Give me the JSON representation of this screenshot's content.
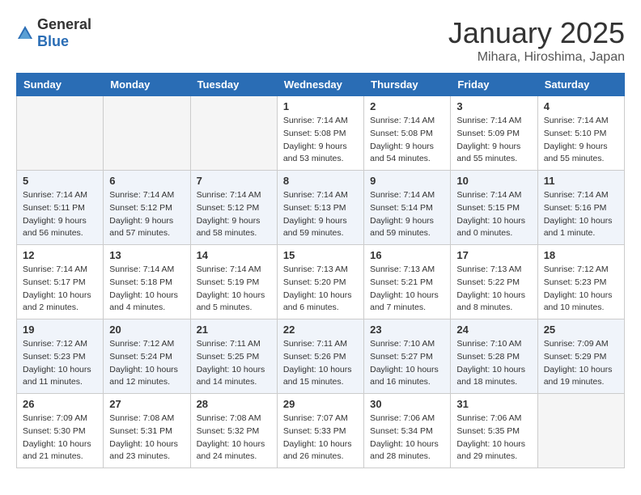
{
  "logo": {
    "general": "General",
    "blue": "Blue"
  },
  "title": "January 2025",
  "location": "Mihara, Hiroshima, Japan",
  "weekdays": [
    "Sunday",
    "Monday",
    "Tuesday",
    "Wednesday",
    "Thursday",
    "Friday",
    "Saturday"
  ],
  "weeks": [
    [
      {
        "day": "",
        "info": ""
      },
      {
        "day": "",
        "info": ""
      },
      {
        "day": "",
        "info": ""
      },
      {
        "day": "1",
        "info": "Sunrise: 7:14 AM\nSunset: 5:08 PM\nDaylight: 9 hours and 53 minutes."
      },
      {
        "day": "2",
        "info": "Sunrise: 7:14 AM\nSunset: 5:08 PM\nDaylight: 9 hours and 54 minutes."
      },
      {
        "day": "3",
        "info": "Sunrise: 7:14 AM\nSunset: 5:09 PM\nDaylight: 9 hours and 55 minutes."
      },
      {
        "day": "4",
        "info": "Sunrise: 7:14 AM\nSunset: 5:10 PM\nDaylight: 9 hours and 55 minutes."
      }
    ],
    [
      {
        "day": "5",
        "info": "Sunrise: 7:14 AM\nSunset: 5:11 PM\nDaylight: 9 hours and 56 minutes."
      },
      {
        "day": "6",
        "info": "Sunrise: 7:14 AM\nSunset: 5:12 PM\nDaylight: 9 hours and 57 minutes."
      },
      {
        "day": "7",
        "info": "Sunrise: 7:14 AM\nSunset: 5:12 PM\nDaylight: 9 hours and 58 minutes."
      },
      {
        "day": "8",
        "info": "Sunrise: 7:14 AM\nSunset: 5:13 PM\nDaylight: 9 hours and 59 minutes."
      },
      {
        "day": "9",
        "info": "Sunrise: 7:14 AM\nSunset: 5:14 PM\nDaylight: 9 hours and 59 minutes."
      },
      {
        "day": "10",
        "info": "Sunrise: 7:14 AM\nSunset: 5:15 PM\nDaylight: 10 hours and 0 minutes."
      },
      {
        "day": "11",
        "info": "Sunrise: 7:14 AM\nSunset: 5:16 PM\nDaylight: 10 hours and 1 minute."
      }
    ],
    [
      {
        "day": "12",
        "info": "Sunrise: 7:14 AM\nSunset: 5:17 PM\nDaylight: 10 hours and 2 minutes."
      },
      {
        "day": "13",
        "info": "Sunrise: 7:14 AM\nSunset: 5:18 PM\nDaylight: 10 hours and 4 minutes."
      },
      {
        "day": "14",
        "info": "Sunrise: 7:14 AM\nSunset: 5:19 PM\nDaylight: 10 hours and 5 minutes."
      },
      {
        "day": "15",
        "info": "Sunrise: 7:13 AM\nSunset: 5:20 PM\nDaylight: 10 hours and 6 minutes."
      },
      {
        "day": "16",
        "info": "Sunrise: 7:13 AM\nSunset: 5:21 PM\nDaylight: 10 hours and 7 minutes."
      },
      {
        "day": "17",
        "info": "Sunrise: 7:13 AM\nSunset: 5:22 PM\nDaylight: 10 hours and 8 minutes."
      },
      {
        "day": "18",
        "info": "Sunrise: 7:12 AM\nSunset: 5:23 PM\nDaylight: 10 hours and 10 minutes."
      }
    ],
    [
      {
        "day": "19",
        "info": "Sunrise: 7:12 AM\nSunset: 5:23 PM\nDaylight: 10 hours and 11 minutes."
      },
      {
        "day": "20",
        "info": "Sunrise: 7:12 AM\nSunset: 5:24 PM\nDaylight: 10 hours and 12 minutes."
      },
      {
        "day": "21",
        "info": "Sunrise: 7:11 AM\nSunset: 5:25 PM\nDaylight: 10 hours and 14 minutes."
      },
      {
        "day": "22",
        "info": "Sunrise: 7:11 AM\nSunset: 5:26 PM\nDaylight: 10 hours and 15 minutes."
      },
      {
        "day": "23",
        "info": "Sunrise: 7:10 AM\nSunset: 5:27 PM\nDaylight: 10 hours and 16 minutes."
      },
      {
        "day": "24",
        "info": "Sunrise: 7:10 AM\nSunset: 5:28 PM\nDaylight: 10 hours and 18 minutes."
      },
      {
        "day": "25",
        "info": "Sunrise: 7:09 AM\nSunset: 5:29 PM\nDaylight: 10 hours and 19 minutes."
      }
    ],
    [
      {
        "day": "26",
        "info": "Sunrise: 7:09 AM\nSunset: 5:30 PM\nDaylight: 10 hours and 21 minutes."
      },
      {
        "day": "27",
        "info": "Sunrise: 7:08 AM\nSunset: 5:31 PM\nDaylight: 10 hours and 23 minutes."
      },
      {
        "day": "28",
        "info": "Sunrise: 7:08 AM\nSunset: 5:32 PM\nDaylight: 10 hours and 24 minutes."
      },
      {
        "day": "29",
        "info": "Sunrise: 7:07 AM\nSunset: 5:33 PM\nDaylight: 10 hours and 26 minutes."
      },
      {
        "day": "30",
        "info": "Sunrise: 7:06 AM\nSunset: 5:34 PM\nDaylight: 10 hours and 28 minutes."
      },
      {
        "day": "31",
        "info": "Sunrise: 7:06 AM\nSunset: 5:35 PM\nDaylight: 10 hours and 29 minutes."
      },
      {
        "day": "",
        "info": ""
      }
    ]
  ]
}
